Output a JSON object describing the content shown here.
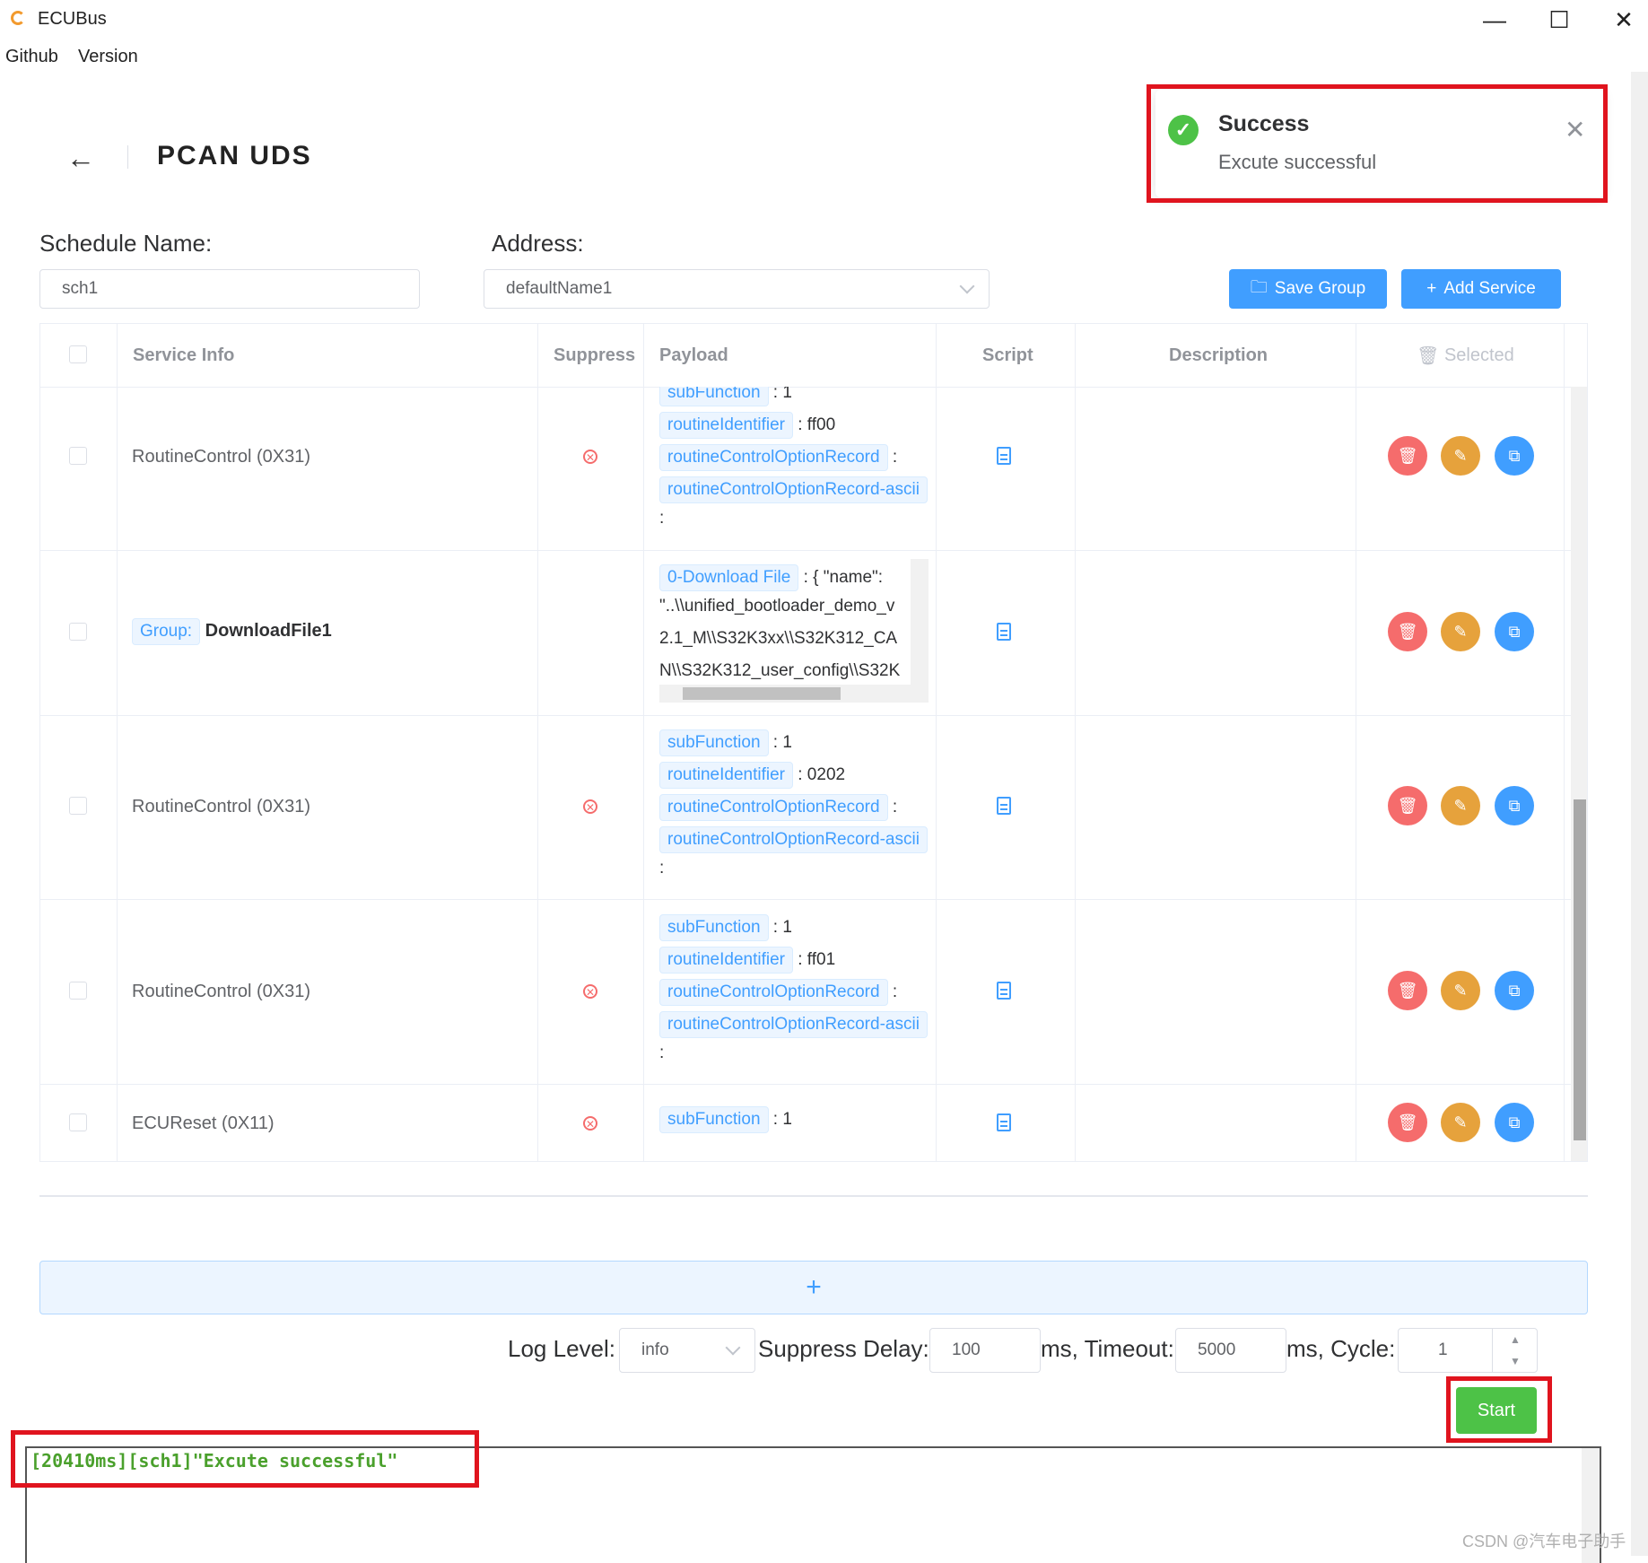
{
  "window": {
    "title": "ECUBus",
    "minimize": "—",
    "maximize": "☐",
    "close": "✕"
  },
  "menu": [
    "Github",
    "Version"
  ],
  "header": {
    "back": "←",
    "title": "PCAN UDS"
  },
  "notification": {
    "title": "Success",
    "message": "Excute successful",
    "close": "✕",
    "icon": "check-circle"
  },
  "form": {
    "schedule_label": "Schedule Name:",
    "schedule_value": "sch1",
    "address_label": "Address:",
    "address_value": "defaultName1",
    "save_group": "Save Group",
    "add_service": "Add Service"
  },
  "table": {
    "headers": {
      "service": "Service Info",
      "suppress": "Suppress",
      "payload": "Payload",
      "script": "Script",
      "description": "Description",
      "selected": "Selected"
    },
    "rows": [
      {
        "service": "RoutineControl (0X31)",
        "payload": [
          [
            "subFunction",
            ": 1"
          ],
          [
            "routineIdentifier",
            ": ff00"
          ],
          [
            "routineControlOptionRecord",
            ":"
          ],
          [
            "routineControlOptionRecord-ascii",
            ""
          ],
          [
            "",
            ":"
          ]
        ]
      },
      {
        "group": "Group:",
        "service": "DownloadFile1",
        "payload": [
          [
            "0-Download File",
            ": { \"name\":"
          ],
          [
            "",
            "\"..\\\\unified_bootloader_demo_v"
          ],
          [
            "",
            "2.1_M\\\\S32K3xx\\\\S32K312_CA"
          ],
          [
            "",
            "N\\\\S32K312_user_config\\\\S32K"
          ]
        ]
      },
      {
        "service": "RoutineControl (0X31)",
        "payload": [
          [
            "subFunction",
            ": 1"
          ],
          [
            "routineIdentifier",
            ": 0202"
          ],
          [
            "routineControlOptionRecord",
            ":"
          ],
          [
            "routineControlOptionRecord-ascii",
            ""
          ],
          [
            "",
            ":"
          ]
        ]
      },
      {
        "service": "RoutineControl (0X31)",
        "payload": [
          [
            "subFunction",
            ": 1"
          ],
          [
            "routineIdentifier",
            ": ff01"
          ],
          [
            "routineControlOptionRecord",
            ":"
          ],
          [
            "routineControlOptionRecord-ascii",
            ""
          ],
          [
            "",
            ":"
          ]
        ]
      },
      {
        "service": "ECUReset (0X11)",
        "payload": [
          [
            "subFunction",
            ": 1"
          ]
        ]
      }
    ]
  },
  "add_bar": "+",
  "controls": {
    "log_level_label": "Log Level:",
    "log_level_value": "info",
    "suppress_delay_label": "Suppress Delay:",
    "suppress_delay_value": "100",
    "timeout_label": "ms, Timeout:",
    "timeout_value": "5000",
    "cycle_label": "ms, Cycle:",
    "cycle_value": "1",
    "start": "Start"
  },
  "log": {
    "line": "[20410ms][sch1]\"Excute successful\""
  },
  "watermark": "CSDN @汽车电子助手"
}
